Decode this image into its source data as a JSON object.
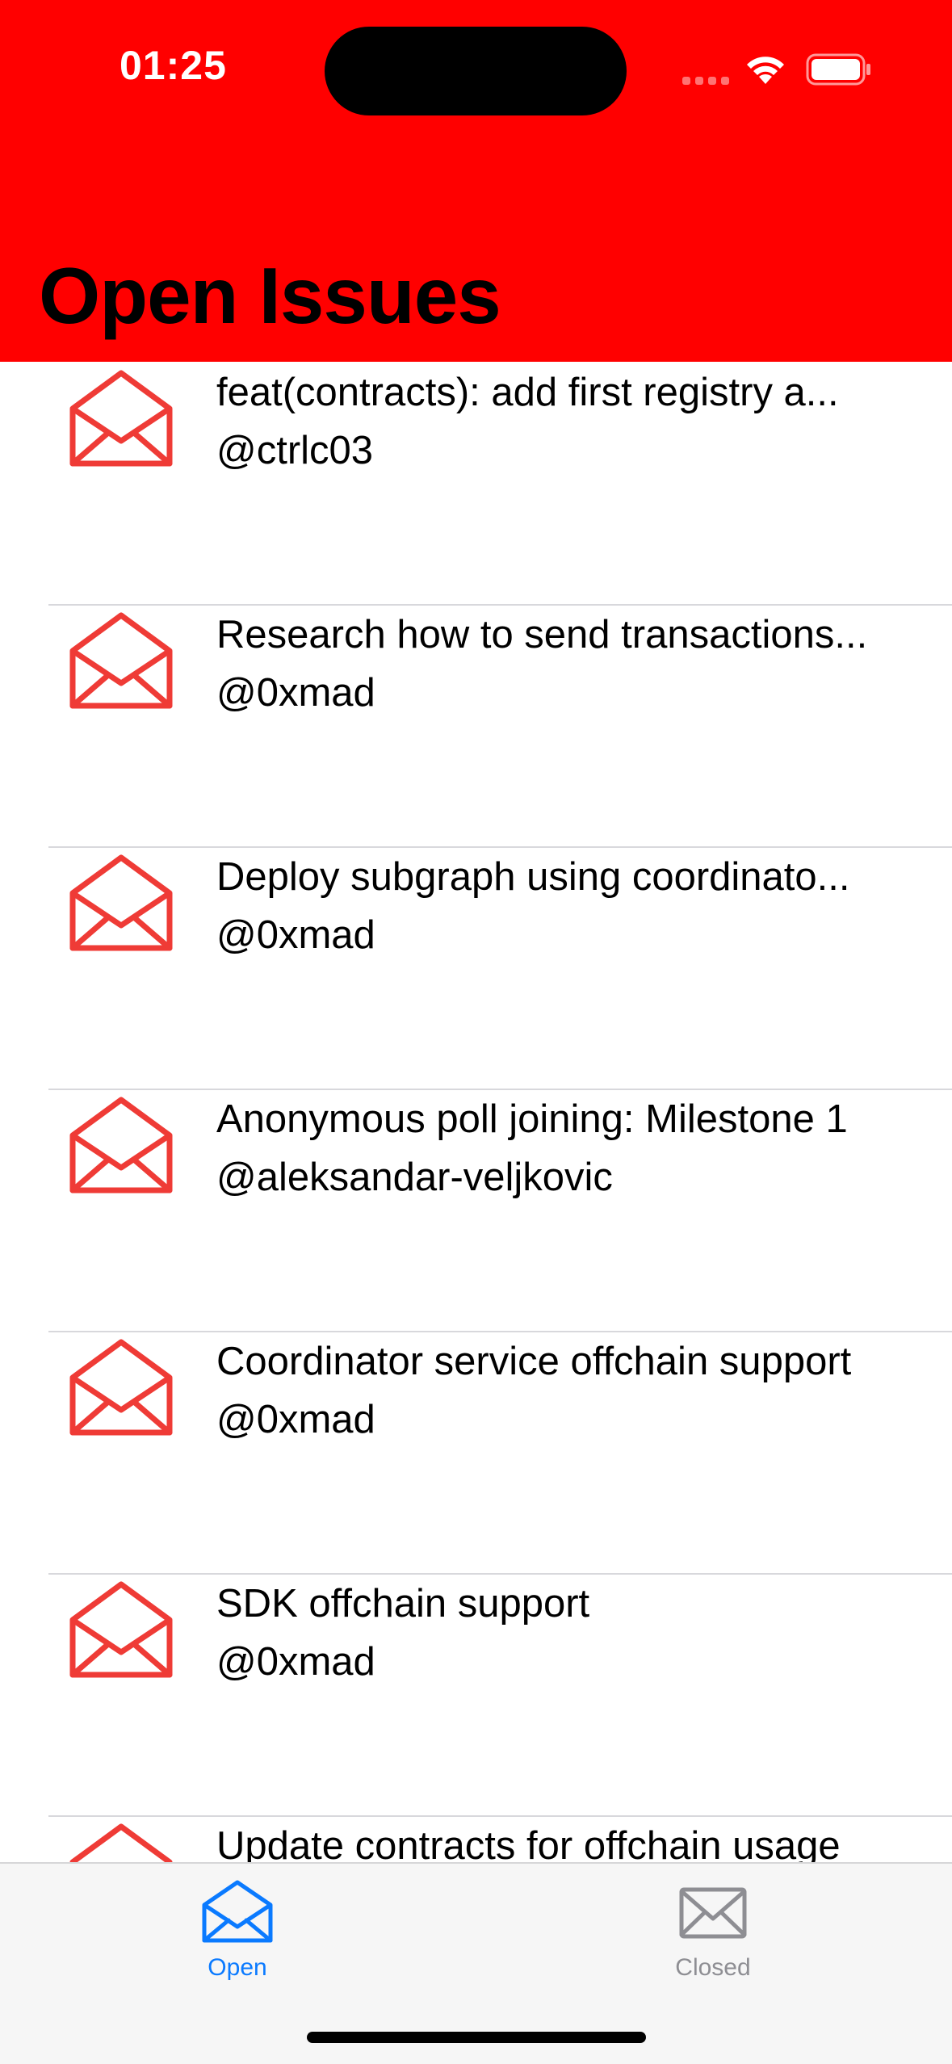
{
  "status_bar": {
    "time": "01:25",
    "wifi_icon": "wifi-icon",
    "battery_icon": "battery-icon"
  },
  "header": {
    "title": "Open Issues",
    "background": "#ff0000"
  },
  "issues": [
    {
      "title": "feat(contracts): add first registry a...",
      "author": "@ctrlc03",
      "icon": "envelope-open-icon"
    },
    {
      "title": "Research how to send transactions...",
      "author": "@0xmad",
      "icon": "envelope-open-icon"
    },
    {
      "title": "Deploy subgraph using coordinato...",
      "author": "@0xmad",
      "icon": "envelope-open-icon"
    },
    {
      "title": "Anonymous poll joining: Milestone 1",
      "author": "@aleksandar-veljkovic",
      "icon": "envelope-open-icon"
    },
    {
      "title": "Coordinator service offchain support",
      "author": "@0xmad",
      "icon": "envelope-open-icon"
    },
    {
      "title": "SDK offchain support",
      "author": "@0xmad",
      "icon": "envelope-open-icon"
    },
    {
      "title": "Update contracts for offchain usage",
      "author": "",
      "icon": "envelope-open-icon"
    }
  ],
  "tabs": [
    {
      "label": "Open",
      "icon": "envelope-open-icon",
      "selected": true,
      "color": "#0a7aff"
    },
    {
      "label": "Closed",
      "icon": "envelope-icon",
      "selected": false,
      "color": "#8e8e93"
    }
  ],
  "colors": {
    "issue_icon": "#ef3b36",
    "tab_active": "#0a7aff",
    "tab_inactive": "#8e8e93"
  }
}
